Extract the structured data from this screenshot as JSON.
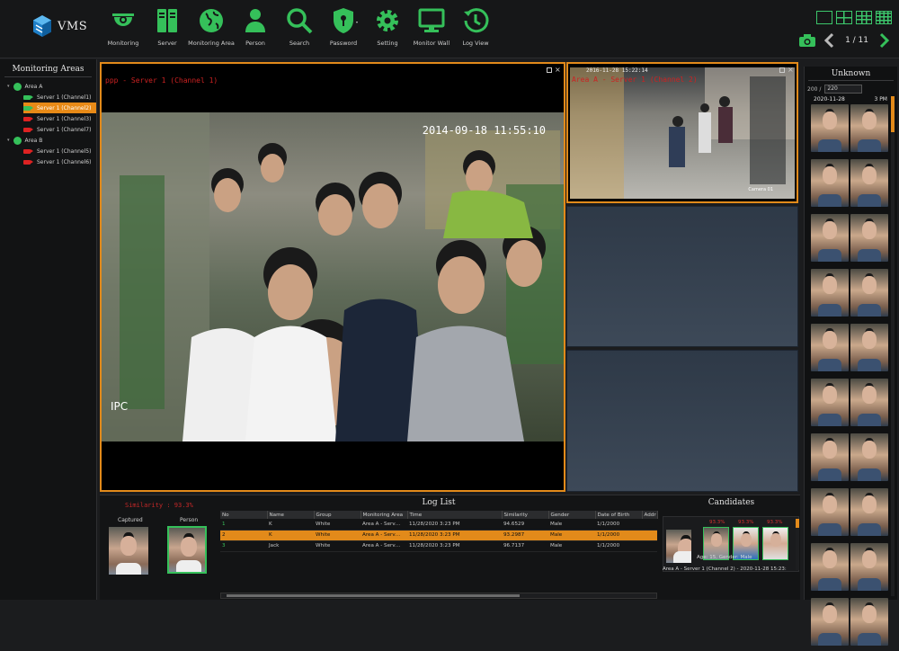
{
  "app": {
    "logo_text": "VMS"
  },
  "toolbar": [
    {
      "label": "Monitoring",
      "icon": "camera-dome-icon"
    },
    {
      "label": "Server",
      "icon": "server-icon"
    },
    {
      "label": "Monitoring Area",
      "icon": "globe-icon"
    },
    {
      "label": "Person",
      "icon": "person-icon"
    },
    {
      "label": "Search",
      "icon": "search-icon"
    },
    {
      "label": "Password",
      "icon": "shield-key-icon"
    },
    {
      "label": "Setting",
      "icon": "gear-icon"
    },
    {
      "label": "Monitor Wall",
      "icon": "monitor-icon"
    },
    {
      "label": "Log View",
      "icon": "history-icon"
    }
  ],
  "pager": {
    "text": "1 / 11"
  },
  "sidebar": {
    "title": "Monitoring Areas",
    "areas": [
      {
        "name": "Area A",
        "channels": [
          {
            "label": "Server 1 (Channel1)",
            "status": "green"
          },
          {
            "label": "Server 1 (Channel2)",
            "status": "green",
            "selected": true
          },
          {
            "label": "Server 1 (Channel3)",
            "status": "red"
          },
          {
            "label": "Server 1 (Channel7)",
            "status": "red"
          }
        ]
      },
      {
        "name": "Area B",
        "channels": [
          {
            "label": "Server 1 (Channel5)",
            "status": "red"
          },
          {
            "label": "Server 1 (Channel6)",
            "status": "red"
          }
        ]
      }
    ]
  },
  "main_video": {
    "title": "ppp - Server 1 (Channel 1)",
    "timestamp": "2014-09-18 11:55:10",
    "overlay": "IPC"
  },
  "second_video": {
    "title": "Area A - Server 1 (Channel 2)",
    "timestamp": "2016-11-28 15:22:14",
    "label": "Camera 01"
  },
  "unknown_panel": {
    "title": "Unknown",
    "count_label": "200 /",
    "count_value": "220",
    "date": "2020-11-28",
    "time": "3 PM"
  },
  "similarity": {
    "header": "Similarity : 93.3%",
    "captured_label": "Captured",
    "person_label": "Person"
  },
  "log": {
    "title": "Log List",
    "columns": [
      "No",
      "Name",
      "Group",
      "Monitoring Area",
      "Time",
      "Similarity",
      "Gender",
      "Date of Birth",
      "Addr"
    ],
    "rows": [
      [
        "1",
        "K",
        "White",
        "Area A - Serv…",
        "11/28/2020 3:23 PM",
        "94.6529",
        "Male",
        "1/1/2000",
        ""
      ],
      [
        "2",
        "K",
        "White",
        "Area A - Serv…",
        "11/28/2020 3:23 PM",
        "93.2987",
        "Male",
        "1/1/2000",
        ""
      ],
      [
        "3",
        "Jack",
        "White",
        "Area A - Serv…",
        "11/28/2020 3:23 PM",
        "96.7137",
        "Male",
        "1/1/2000",
        ""
      ]
    ],
    "selected_row": 1
  },
  "candidates": {
    "title": "Candidates",
    "percents": [
      "93.3%",
      "93.3%",
      "93.3%"
    ],
    "info": "Age: 15, Gender: Male",
    "source": "Area A - Server 1 (Channel 2) - 2020-11-28 15:23:"
  },
  "colors": {
    "accent_orange": "#e28a1a",
    "icon_green": "#35c05a",
    "alert_red": "#c62828"
  }
}
